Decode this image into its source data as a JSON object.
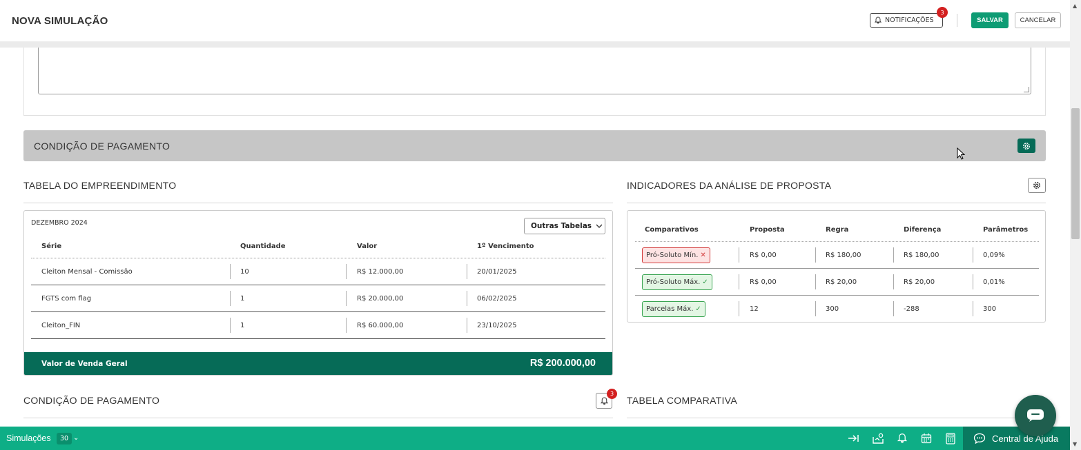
{
  "header": {
    "title": "NOVA SIMULAÇÃO",
    "notifications_label": "NOTIFICAÇÕES",
    "notifications_count": "3",
    "save_label": "SALVAR",
    "cancel_label": "CANCELAR"
  },
  "payment_bar": {
    "title": "CONDIÇÃO DE PAGAMENTO"
  },
  "development_table": {
    "title": "TABELA DO EMPREENDIMENTO",
    "month": "DEZEMBRO 2024",
    "other_tables_label": "Outras Tabelas",
    "columns": [
      "Série",
      "Quantidade",
      "Valor",
      "1º Vencimento"
    ],
    "rows": [
      [
        "Cleiton Mensal - Comissão",
        "10",
        "R$ 12.000,00",
        "20/01/2025"
      ],
      [
        "FGTS com flag",
        "1",
        "R$ 20.000,00",
        "06/02/2025"
      ],
      [
        "Cleiton_FIN",
        "1",
        "R$ 60.000,00",
        "23/10/2025"
      ]
    ],
    "total_label": "Valor de Venda Geral",
    "total_value": "R$ 200.000,00"
  },
  "indicators": {
    "title": "INDICADORES DA ANÁLISE DE PROPOSTA",
    "columns": [
      "Comparativos",
      "Proposta",
      "Regra",
      "Diferença",
      "Parâmetros"
    ],
    "rows": [
      {
        "label": "Pró-Soluto Mín.",
        "status": "bad",
        "mark": "✕",
        "proposta": "R$ 0,00",
        "regra": "R$ 180,00",
        "diferenca": "R$ 180,00",
        "parametros": "0,09%"
      },
      {
        "label": "Pró-Soluto Máx.",
        "status": "good",
        "mark": "✓",
        "proposta": "R$ 0,00",
        "regra": "R$ 20,00",
        "diferenca": "R$ 20,00",
        "parametros": "0,01%"
      },
      {
        "label": "Parcelas Máx.",
        "status": "good",
        "mark": "✓",
        "proposta": "12",
        "regra": "300",
        "diferenca": "-288",
        "parametros": "300"
      }
    ]
  },
  "payment_section": {
    "title": "CONDIÇÃO DE PAGAMENTO",
    "badge_count": "3"
  },
  "comparison_section": {
    "title": "TABELA COMPARATIVA"
  },
  "bottom_bar": {
    "simulations_label": "Simulações",
    "simulations_count": "30",
    "help_label": "Central de Ajuda",
    "icons": [
      "arrow-to-right-icon",
      "map-marker-icon",
      "bell-icon",
      "calendar-icon",
      "calculator-icon",
      "chat-icon"
    ]
  },
  "colors": {
    "brand_dark": "#066b57",
    "brand": "#0eae86",
    "danger": "#d32020",
    "section_bar": "#c6c6c6"
  }
}
